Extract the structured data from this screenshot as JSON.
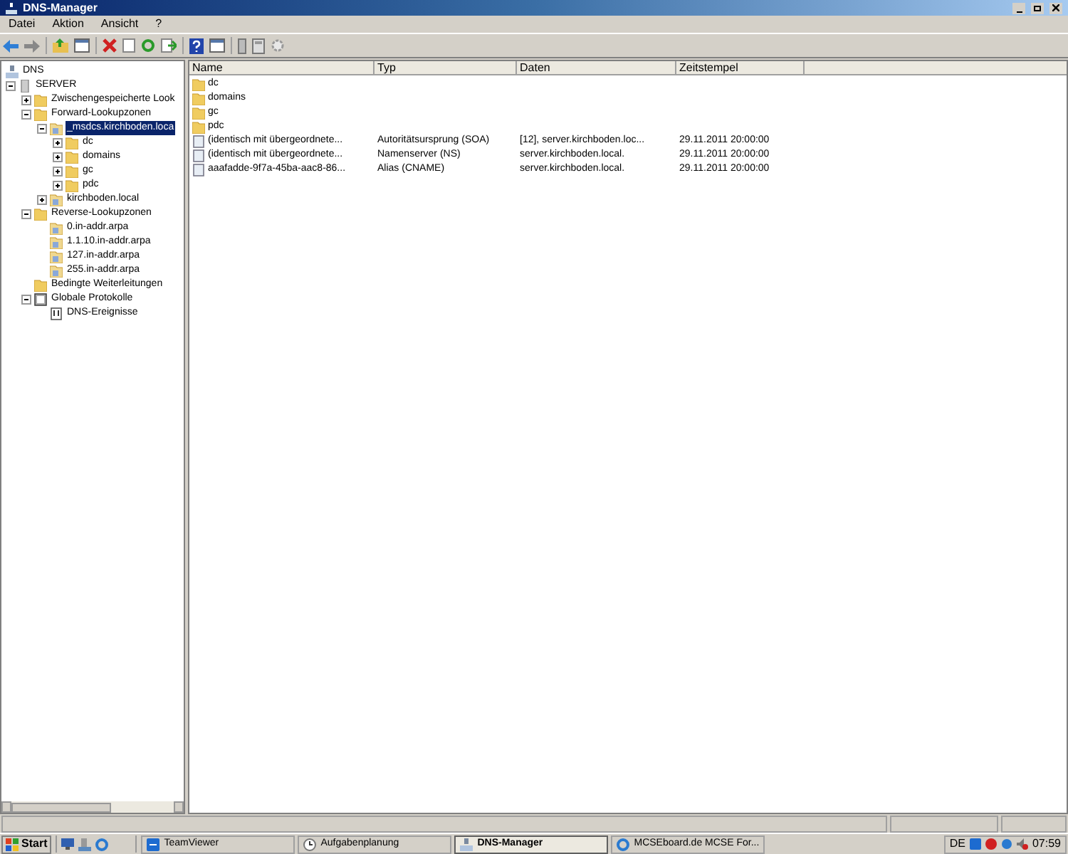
{
  "window": {
    "title": "DNS-Manager"
  },
  "menu": [
    "Datei",
    "Aktion",
    "Ansicht",
    "?"
  ],
  "tree": [
    {
      "label": "DNS",
      "kind": "dns",
      "selected": false,
      "children": [
        {
          "label": "SERVER",
          "kind": "server",
          "expanded": true,
          "selected": false,
          "children": [
            {
              "label": "Zwischengespeicherte Look",
              "kind": "folder",
              "expanded": false,
              "selected": false
            },
            {
              "label": "Forward-Lookupzonen",
              "kind": "folder",
              "expanded": true,
              "selected": false,
              "children": [
                {
                  "label": "_msdcs.kirchboden.loca",
                  "kind": "zone",
                  "expanded": true,
                  "selected": true,
                  "children": [
                    {
                      "label": "dc",
                      "kind": "folder",
                      "expanded": false,
                      "selected": false
                    },
                    {
                      "label": "domains",
                      "kind": "folder",
                      "expanded": false,
                      "selected": false
                    },
                    {
                      "label": "gc",
                      "kind": "folder",
                      "expanded": false,
                      "selected": false
                    },
                    {
                      "label": "pdc",
                      "kind": "folder",
                      "expanded": false,
                      "selected": false
                    }
                  ]
                },
                {
                  "label": "kirchboden.local",
                  "kind": "zone",
                  "expanded": false,
                  "selected": false
                }
              ]
            },
            {
              "label": "Reverse-Lookupzonen",
              "kind": "folder",
              "expanded": true,
              "selected": false,
              "children": [
                {
                  "label": "0.in-addr.arpa",
                  "kind": "zone",
                  "selected": false
                },
                {
                  "label": "1.1.10.in-addr.arpa",
                  "kind": "zone",
                  "selected": false
                },
                {
                  "label": "127.in-addr.arpa",
                  "kind": "zone",
                  "selected": false
                },
                {
                  "label": "255.in-addr.arpa",
                  "kind": "zone",
                  "selected": false
                }
              ]
            },
            {
              "label": "Bedingte Weiterleitungen",
              "kind": "folder",
              "selected": false
            },
            {
              "label": "Globale Protokolle",
              "kind": "log",
              "expanded": true,
              "selected": false,
              "children": [
                {
                  "label": "DNS-Ereignisse",
                  "kind": "events",
                  "selected": false
                }
              ]
            }
          ]
        }
      ]
    }
  ],
  "table": {
    "columns": [
      "Name",
      "Typ",
      "Daten",
      "Zeitstempel"
    ],
    "rows": [
      {
        "kind": "folder",
        "cells": [
          "dc"
        ]
      },
      {
        "kind": "folder",
        "cells": [
          "domains"
        ]
      },
      {
        "kind": "folder",
        "cells": [
          "gc"
        ]
      },
      {
        "kind": "folder",
        "cells": [
          "pdc"
        ]
      },
      {
        "kind": "record",
        "cells": [
          "(identisch mit übergeordnete...",
          "Autoritätsursprung (SOA)",
          "[12], server.kirchboden.loc...",
          "29.11.2011 20:00:00"
        ]
      },
      {
        "kind": "record",
        "cells": [
          "(identisch mit übergeordnete...",
          "Namenserver (NS)",
          "server.kirchboden.local.",
          "29.11.2011 20:00:00"
        ]
      },
      {
        "kind": "record",
        "cells": [
          "aaafadde-9f7a-45ba-aac8-86...",
          "Alias (CNAME)",
          "server.kirchboden.local.",
          "29.11.2011 20:00:00"
        ]
      }
    ]
  },
  "taskbar": {
    "start": "Start",
    "tasks": [
      {
        "label": "TeamViewer",
        "kind": "teamviewer",
        "selected": false
      },
      {
        "label": "Aufgabenplanung",
        "kind": "clock",
        "selected": false
      },
      {
        "label": "DNS-Manager",
        "kind": "dns",
        "selected": true
      },
      {
        "label": "MCSEboard.de MCSE For...",
        "kind": "browser",
        "selected": false
      }
    ],
    "language": "DE",
    "clock": "07:59"
  }
}
